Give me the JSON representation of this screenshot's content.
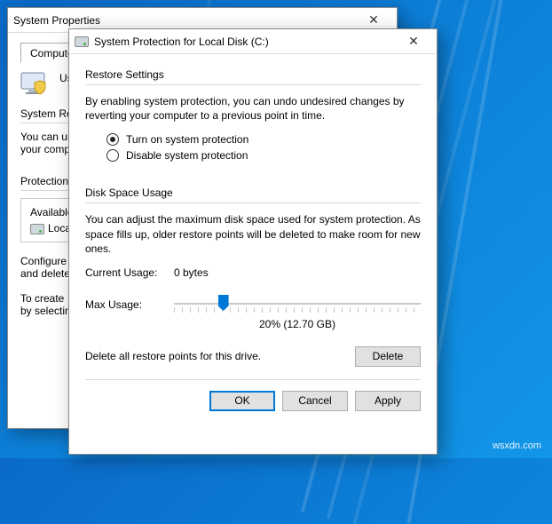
{
  "watermark": "wsxdn.com",
  "back": {
    "title": "System Properties",
    "tab": "Computer Na",
    "use_label": "Us",
    "sysres_heading": "System Res",
    "sysres_text1": "You can un",
    "sysres_text2": "your compu",
    "protection_heading": "Protection S",
    "available_label": "Available",
    "local_label": "Loca",
    "configure1": "Configure",
    "configure2": "and delete",
    "create1": "To create",
    "create2": "by selectin"
  },
  "front": {
    "title": "System Protection for Local Disk (C:)",
    "restore_group": "Restore Settings",
    "restore_help": "By enabling system protection, you can undo undesired changes by reverting your computer to a previous point in time.",
    "radio_on": "Turn on system protection",
    "radio_off": "Disable system protection",
    "disk_group": "Disk Space Usage",
    "disk_help": "You can adjust the maximum disk space used for system protection. As space fills up, older restore points will be deleted to make room for new ones.",
    "current_label": "Current Usage:",
    "current_value": "0 bytes",
    "max_label": "Max Usage:",
    "max_value": "20% (12.70 GB)",
    "delete_help": "Delete all restore points for this drive.",
    "delete_btn": "Delete",
    "ok": "OK",
    "cancel": "Cancel",
    "apply": "Apply"
  }
}
